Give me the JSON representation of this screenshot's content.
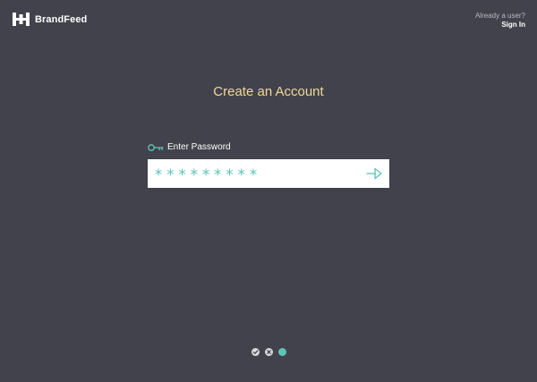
{
  "header": {
    "brand_name": "BrandFeed",
    "already_user_text": "Already a user?",
    "sign_in_label": "Sign In"
  },
  "main": {
    "title": "Create an Account",
    "password_label": "Enter Password",
    "password_value": "*********"
  },
  "icons": {
    "logo": "brandfeed-logo-icon",
    "key": "key-icon",
    "submit": "arrow-right-icon",
    "step_done": "checkmark-icon",
    "step_skipped": "x-icon"
  },
  "steps": [
    {
      "state": "done"
    },
    {
      "state": "skipped"
    },
    {
      "state": "current"
    }
  ],
  "colors": {
    "background": "#41424b",
    "title": "#f1d89a",
    "accent": "#5ec4b6",
    "input_bg": "#ffffff",
    "step_inactive": "#d9d9d9"
  }
}
